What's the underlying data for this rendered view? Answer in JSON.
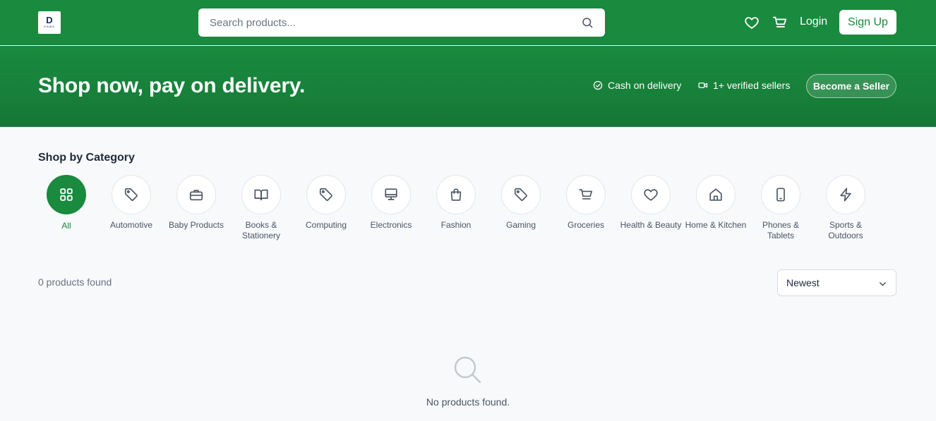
{
  "header": {
    "logo_mark": "D",
    "logo_text": "DAMA",
    "search_placeholder": "Search products...",
    "login_label": "Login",
    "signup_label": "Sign Up"
  },
  "hero": {
    "title": "Shop now, pay on delivery.",
    "features": [
      {
        "icon": "check-circle-icon",
        "label": "Cash on delivery"
      },
      {
        "icon": "video-camera-icon",
        "label": "1+ verified sellers"
      }
    ],
    "seller_button": "Become a Seller"
  },
  "categories": {
    "title": "Shop by Category",
    "items": [
      {
        "label": "All",
        "icon": "grid-icon",
        "active": true
      },
      {
        "label": "Automotive",
        "icon": "tag-icon"
      },
      {
        "label": "Baby Products",
        "icon": "toolbox-icon"
      },
      {
        "label": "Books & Stationery",
        "icon": "book-open-icon"
      },
      {
        "label": "Computing",
        "icon": "tag-icon"
      },
      {
        "label": "Electronics",
        "icon": "monitor-icon"
      },
      {
        "label": "Fashion",
        "icon": "shopping-bag-icon"
      },
      {
        "label": "Gaming",
        "icon": "tag-icon"
      },
      {
        "label": "Groceries",
        "icon": "cart-icon"
      },
      {
        "label": "Health & Beauty",
        "icon": "heart-icon"
      },
      {
        "label": "Home & Kitchen",
        "icon": "home-icon"
      },
      {
        "label": "Phones & Tablets",
        "icon": "smartphone-icon"
      },
      {
        "label": "Sports & Outdoors",
        "icon": "lightning-icon"
      }
    ]
  },
  "results": {
    "count_text": "0 products found",
    "sort_selected": "Newest",
    "empty_text": "No products found."
  },
  "colors": {
    "brand_green": "#198a3e",
    "page_background": "#f7f9fb"
  }
}
